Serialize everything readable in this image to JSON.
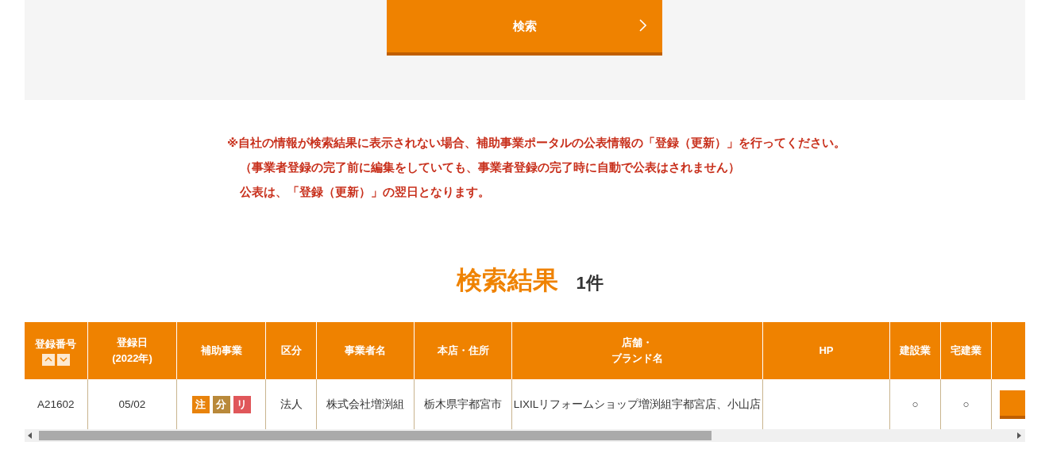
{
  "search_panel": {
    "button": {
      "label": "検索"
    }
  },
  "notes": [
    "※自社の情報が検索結果に表示されない場合、補助事業ポータルの公表情報の「登録（更新）」を行ってください。",
    "（事業者登録の完了前に編集をしていても、事業者登録の完了時に自動で公表はされません）",
    "公表は、「登録（更新）」の翌日となります。"
  ],
  "results": {
    "title": "検索結果",
    "count": "1件"
  },
  "table": {
    "columns": [
      {
        "lines": [
          "登録番号"
        ],
        "sortable": true
      },
      {
        "lines": [
          "登録日",
          "(2022年)"
        ]
      },
      {
        "lines": [
          "補助事業"
        ]
      },
      {
        "lines": [
          "区分"
        ]
      },
      {
        "lines": [
          "事業者名"
        ]
      },
      {
        "lines": [
          "本店・住所"
        ]
      },
      {
        "lines": [
          "店舗・",
          "ブランド名"
        ]
      },
      {
        "lines": [
          "HP"
        ]
      },
      {
        "lines": [
          "建設業"
        ]
      },
      {
        "lines": [
          "宅建業"
        ]
      },
      {}
    ],
    "rows": [
      {
        "cells": [
          {
            "kind": "text",
            "text": "A21602"
          },
          {
            "kind": "text",
            "text": "05/02"
          },
          {
            "kind": "badges",
            "badges": [
              {
                "text": "注",
                "color": "#e8830c"
              },
              {
                "text": "分",
                "color": "#b9893a"
              },
              {
                "text": "リ",
                "color": "#e0575a"
              }
            ]
          },
          {
            "kind": "text",
            "text": "法人"
          },
          {
            "kind": "text",
            "text": "株式会社増渕組"
          },
          {
            "kind": "text",
            "text": "栃木県宇都宮市"
          },
          {
            "kind": "text",
            "text": "LIXILリフォームショップ増渕組宇都宮店、小山店"
          },
          {
            "kind": "empty"
          },
          {
            "kind": "text",
            "text": "○"
          },
          {
            "kind": "text",
            "text": "○"
          },
          {
            "kind": "button"
          }
        ]
      }
    ]
  }
}
